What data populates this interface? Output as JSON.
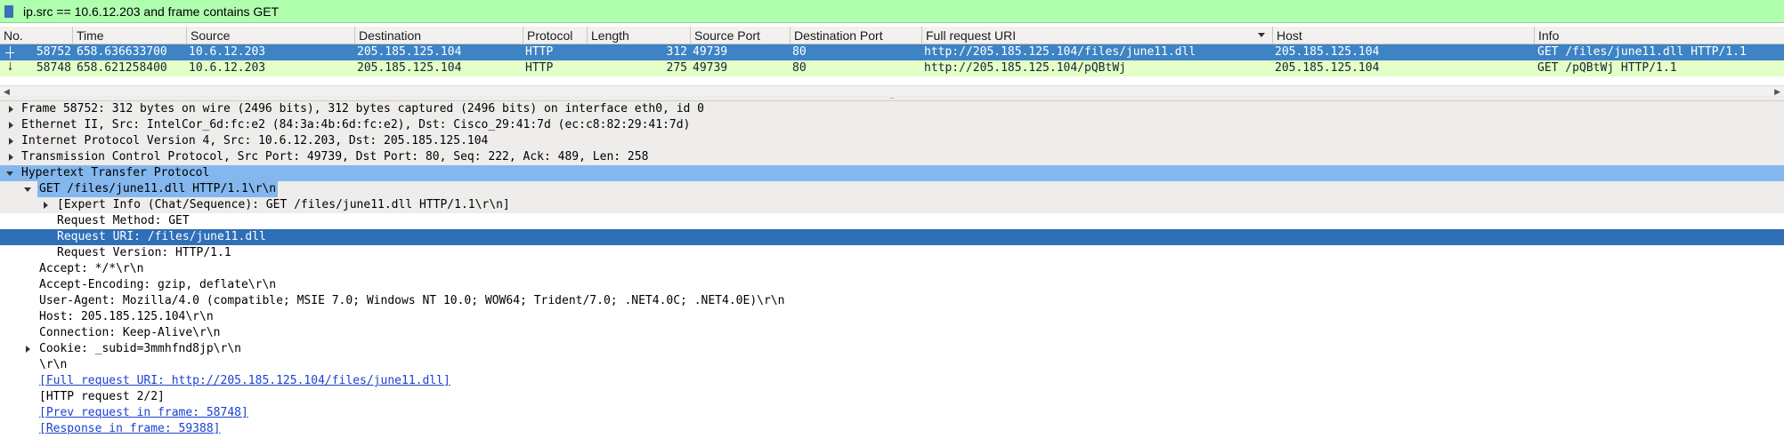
{
  "filter": {
    "expression": "ip.src == 10.6.12.203 and frame contains GET",
    "bg_color": "#afffaf"
  },
  "packet_list": {
    "columns": [
      "No.",
      "Time",
      "Source",
      "Destination",
      "Protocol",
      "Length",
      "Source Port",
      "Destination Port",
      "Full request URI",
      "Host",
      "Info"
    ],
    "sorted_column": "Full request URI",
    "rows": [
      {
        "no": "58752",
        "time": "658.636633700",
        "source": "10.6.12.203",
        "destination": "205.185.125.104",
        "protocol": "HTTP",
        "length": "312",
        "src_port": "49739",
        "dst_port": "80",
        "full_uri": "http://205.185.125.104/files/june11.dll",
        "host": "205.185.125.104",
        "info": "GET /files/june11.dll HTTP/1.1",
        "selected": true
      },
      {
        "no": "58748",
        "time": "658.621258400",
        "source": "10.6.12.203",
        "destination": "205.185.125.104",
        "protocol": "HTTP",
        "length": "275",
        "src_port": "49739",
        "dst_port": "80",
        "full_uri": "http://205.185.125.104/pQBtWj",
        "host": "205.185.125.104",
        "info": "GET /pQBtWj HTTP/1.1",
        "selected": false
      }
    ],
    "selected_color": "#3d83c5",
    "row_color": "#e4ffc7"
  },
  "details": {
    "frame": "Frame 58752: 312 bytes on wire (2496 bits), 312 bytes captured (2496 bits) on interface eth0, id 0",
    "ethernet": "Ethernet II, Src: IntelCor_6d:fc:e2 (84:3a:4b:6d:fc:e2), Dst: Cisco_29:41:7d (ec:c8:82:29:41:7d)",
    "ip": "Internet Protocol Version 4, Src: 10.6.12.203, Dst: 205.185.125.104",
    "tcp": "Transmission Control Protocol, Src Port: 49739, Dst Port: 80, Seq: 222, Ack: 489, Len: 258",
    "http": "Hypertext Transfer Protocol",
    "get_line": "GET /files/june11.dll HTTP/1.1\\r\\n",
    "expert_info": "[Expert Info (Chat/Sequence): GET /files/june11.dll HTTP/1.1\\r\\n]",
    "request_method": "Request Method: GET",
    "request_uri": "Request URI: /files/june11.dll",
    "request_version": "Request Version: HTTP/1.1",
    "accept": "Accept: */*\\r\\n",
    "accept_encoding": "Accept-Encoding: gzip, deflate\\r\\n",
    "user_agent": "User-Agent: Mozilla/4.0 (compatible; MSIE 7.0; Windows NT 10.0; WOW64; Trident/7.0; .NET4.0C; .NET4.0E)\\r\\n",
    "host": "Host: 205.185.125.104\\r\\n",
    "connection": "Connection: Keep-Alive\\r\\n",
    "cookie": "Cookie: _subid=3mmhfnd8jp\\r\\n",
    "crlf": "\\r\\n",
    "full_request_uri": "[Full request URI: http://205.185.125.104/files/june11.dll]",
    "http_request": "[HTTP request 2/2]",
    "prev_request": "[Prev request in frame: 58748]",
    "response_in": "[Response in frame: 59388]"
  }
}
